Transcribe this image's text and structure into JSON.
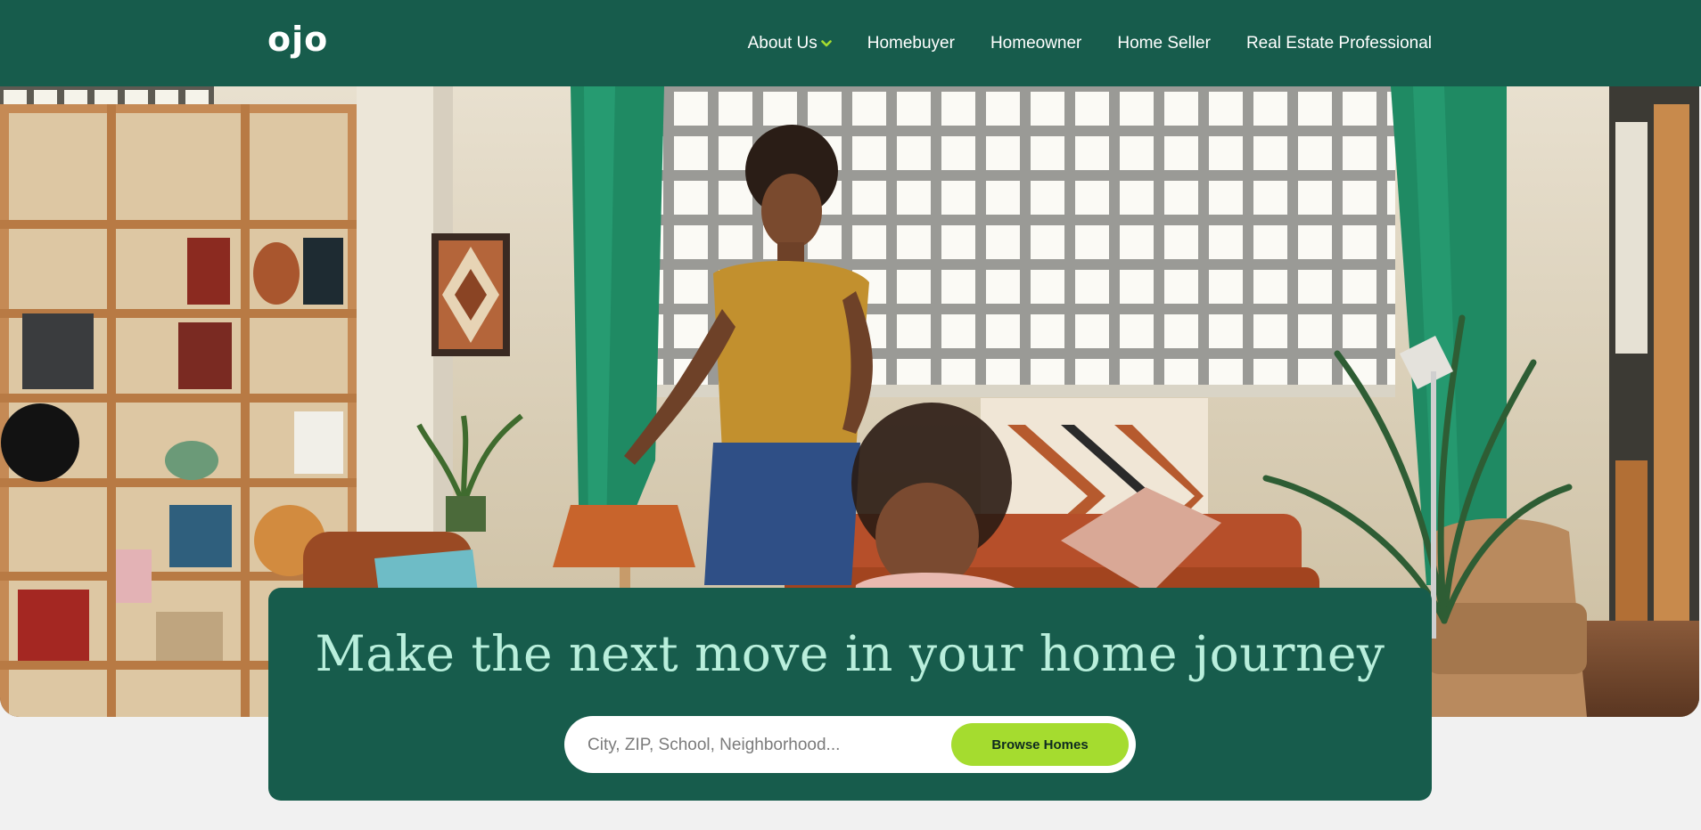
{
  "header": {
    "logo_text": "ojo",
    "nav": [
      {
        "label": "About Us",
        "has_dropdown": true
      },
      {
        "label": "Homebuyer"
      },
      {
        "label": "Homeowner"
      },
      {
        "label": "Home Seller"
      },
      {
        "label": "Real Estate Professional"
      }
    ]
  },
  "hero": {
    "image": "living-room-photo"
  },
  "search_card": {
    "title": "Make the next move in your home journey",
    "search_placeholder": "City, ZIP, School, Neighborhood...",
    "button_label": "Browse Homes"
  },
  "colors": {
    "brand_green": "#175c4c",
    "title_mint": "#b9efdc",
    "button_lime": "#a5dc2f",
    "dropdown_chevron": "#a5dc2f"
  }
}
